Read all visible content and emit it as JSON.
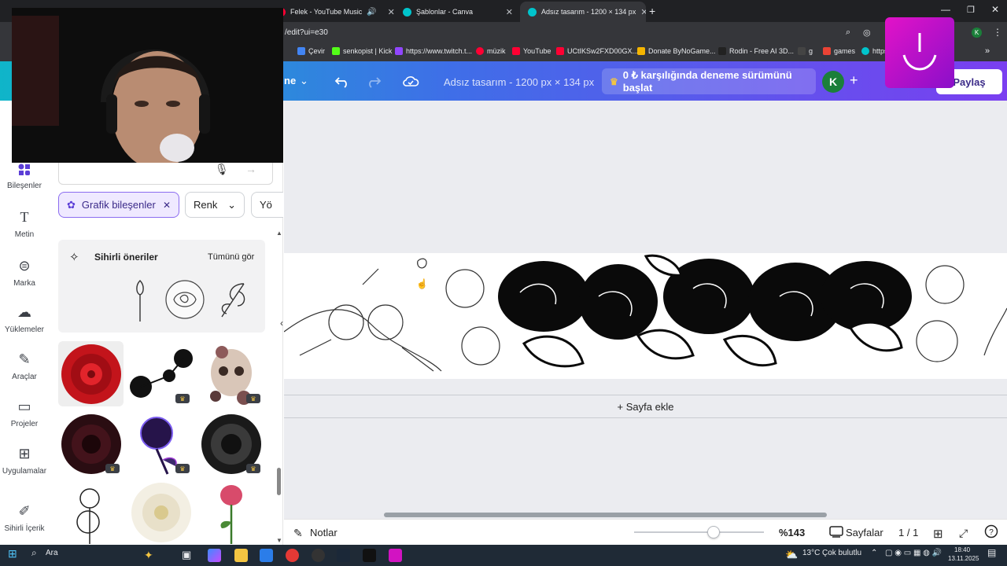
{
  "browser": {
    "tabs": [
      {
        "label": "",
        "color": "#26d07c"
      },
      {
        "label": "",
        "color": "#26d07c"
      },
      {
        "label": "Felek - YouTube Music",
        "color": "#ff0033"
      },
      {
        "label": "Şablonlar - Canva",
        "color": "#00c4cc"
      },
      {
        "label": "Adsız tasarım - 1200 × 134 px",
        "color": "#00c4cc"
      }
    ],
    "new_tab": "+",
    "url": "/edit?ui=e30",
    "bookmarks": [
      {
        "label": "Çevir",
        "color": "#4285f4"
      },
      {
        "label": "senkopist | Kick",
        "color": "#53fc18"
      },
      {
        "label": "https://www.twitch.t...",
        "color": "#9146ff"
      },
      {
        "label": "müzik",
        "color": "#ff0033"
      },
      {
        "label": "YouTube",
        "color": "#ff0033"
      },
      {
        "label": "UCtIKSw2FXD00GX...",
        "color": "#ff0033"
      },
      {
        "label": "Donate ByNoGame...",
        "color": "#f4b400"
      },
      {
        "label": "Rodin - Free AI 3D...",
        "color": "#222222"
      },
      {
        "label": "g",
        "color": "#e8eaed"
      },
      {
        "label": "games",
        "color": "#ea4335"
      },
      {
        "label": "https",
        "color": "#00c4cc"
      }
    ],
    "more_bookmarks": "»"
  },
  "canva_header": {
    "menu_partial": "ne",
    "design_title": "Adsız tasarım - 1200 px × 134 px",
    "trial_label": "0 ₺ karşılığında deneme sürümünü başlat",
    "avatar_letter": "K",
    "plus": "+",
    "share_label": "Paylaş"
  },
  "rail": [
    {
      "label": "Bileşenler",
      "icon": "elements-icon"
    },
    {
      "label": "Metin",
      "icon": "text-icon"
    },
    {
      "label": "Marka",
      "icon": "brand-icon"
    },
    {
      "label": "Yüklemeler",
      "icon": "upload-icon"
    },
    {
      "label": "Araçlar",
      "icon": "draw-icon"
    },
    {
      "label": "Projeler",
      "icon": "folder-icon"
    },
    {
      "label": "Uygulamalar",
      "icon": "apps-icon"
    },
    {
      "label": "Sihirli İçerik",
      "icon": "magic-icon"
    }
  ],
  "panel": {
    "chips": [
      "Grafik bileşenler",
      "Renk",
      "Yö"
    ],
    "magic_title": "Sihirli öneriler",
    "magic_see_all": "Tümünü gör"
  },
  "canvas": {
    "add_page": "+ Sayfa ekle"
  },
  "bottombar": {
    "notes": "Notlar",
    "zoom": "%143",
    "pages_label": "Sayfalar",
    "page_count": "1 / 1",
    "zoom_slider_fraction": 0.61
  },
  "taskbar": {
    "search": "Ara",
    "weather": "13°C",
    "weather_desc": "Çok bulutlu",
    "time": "18:40",
    "date": "13.11.2025"
  }
}
